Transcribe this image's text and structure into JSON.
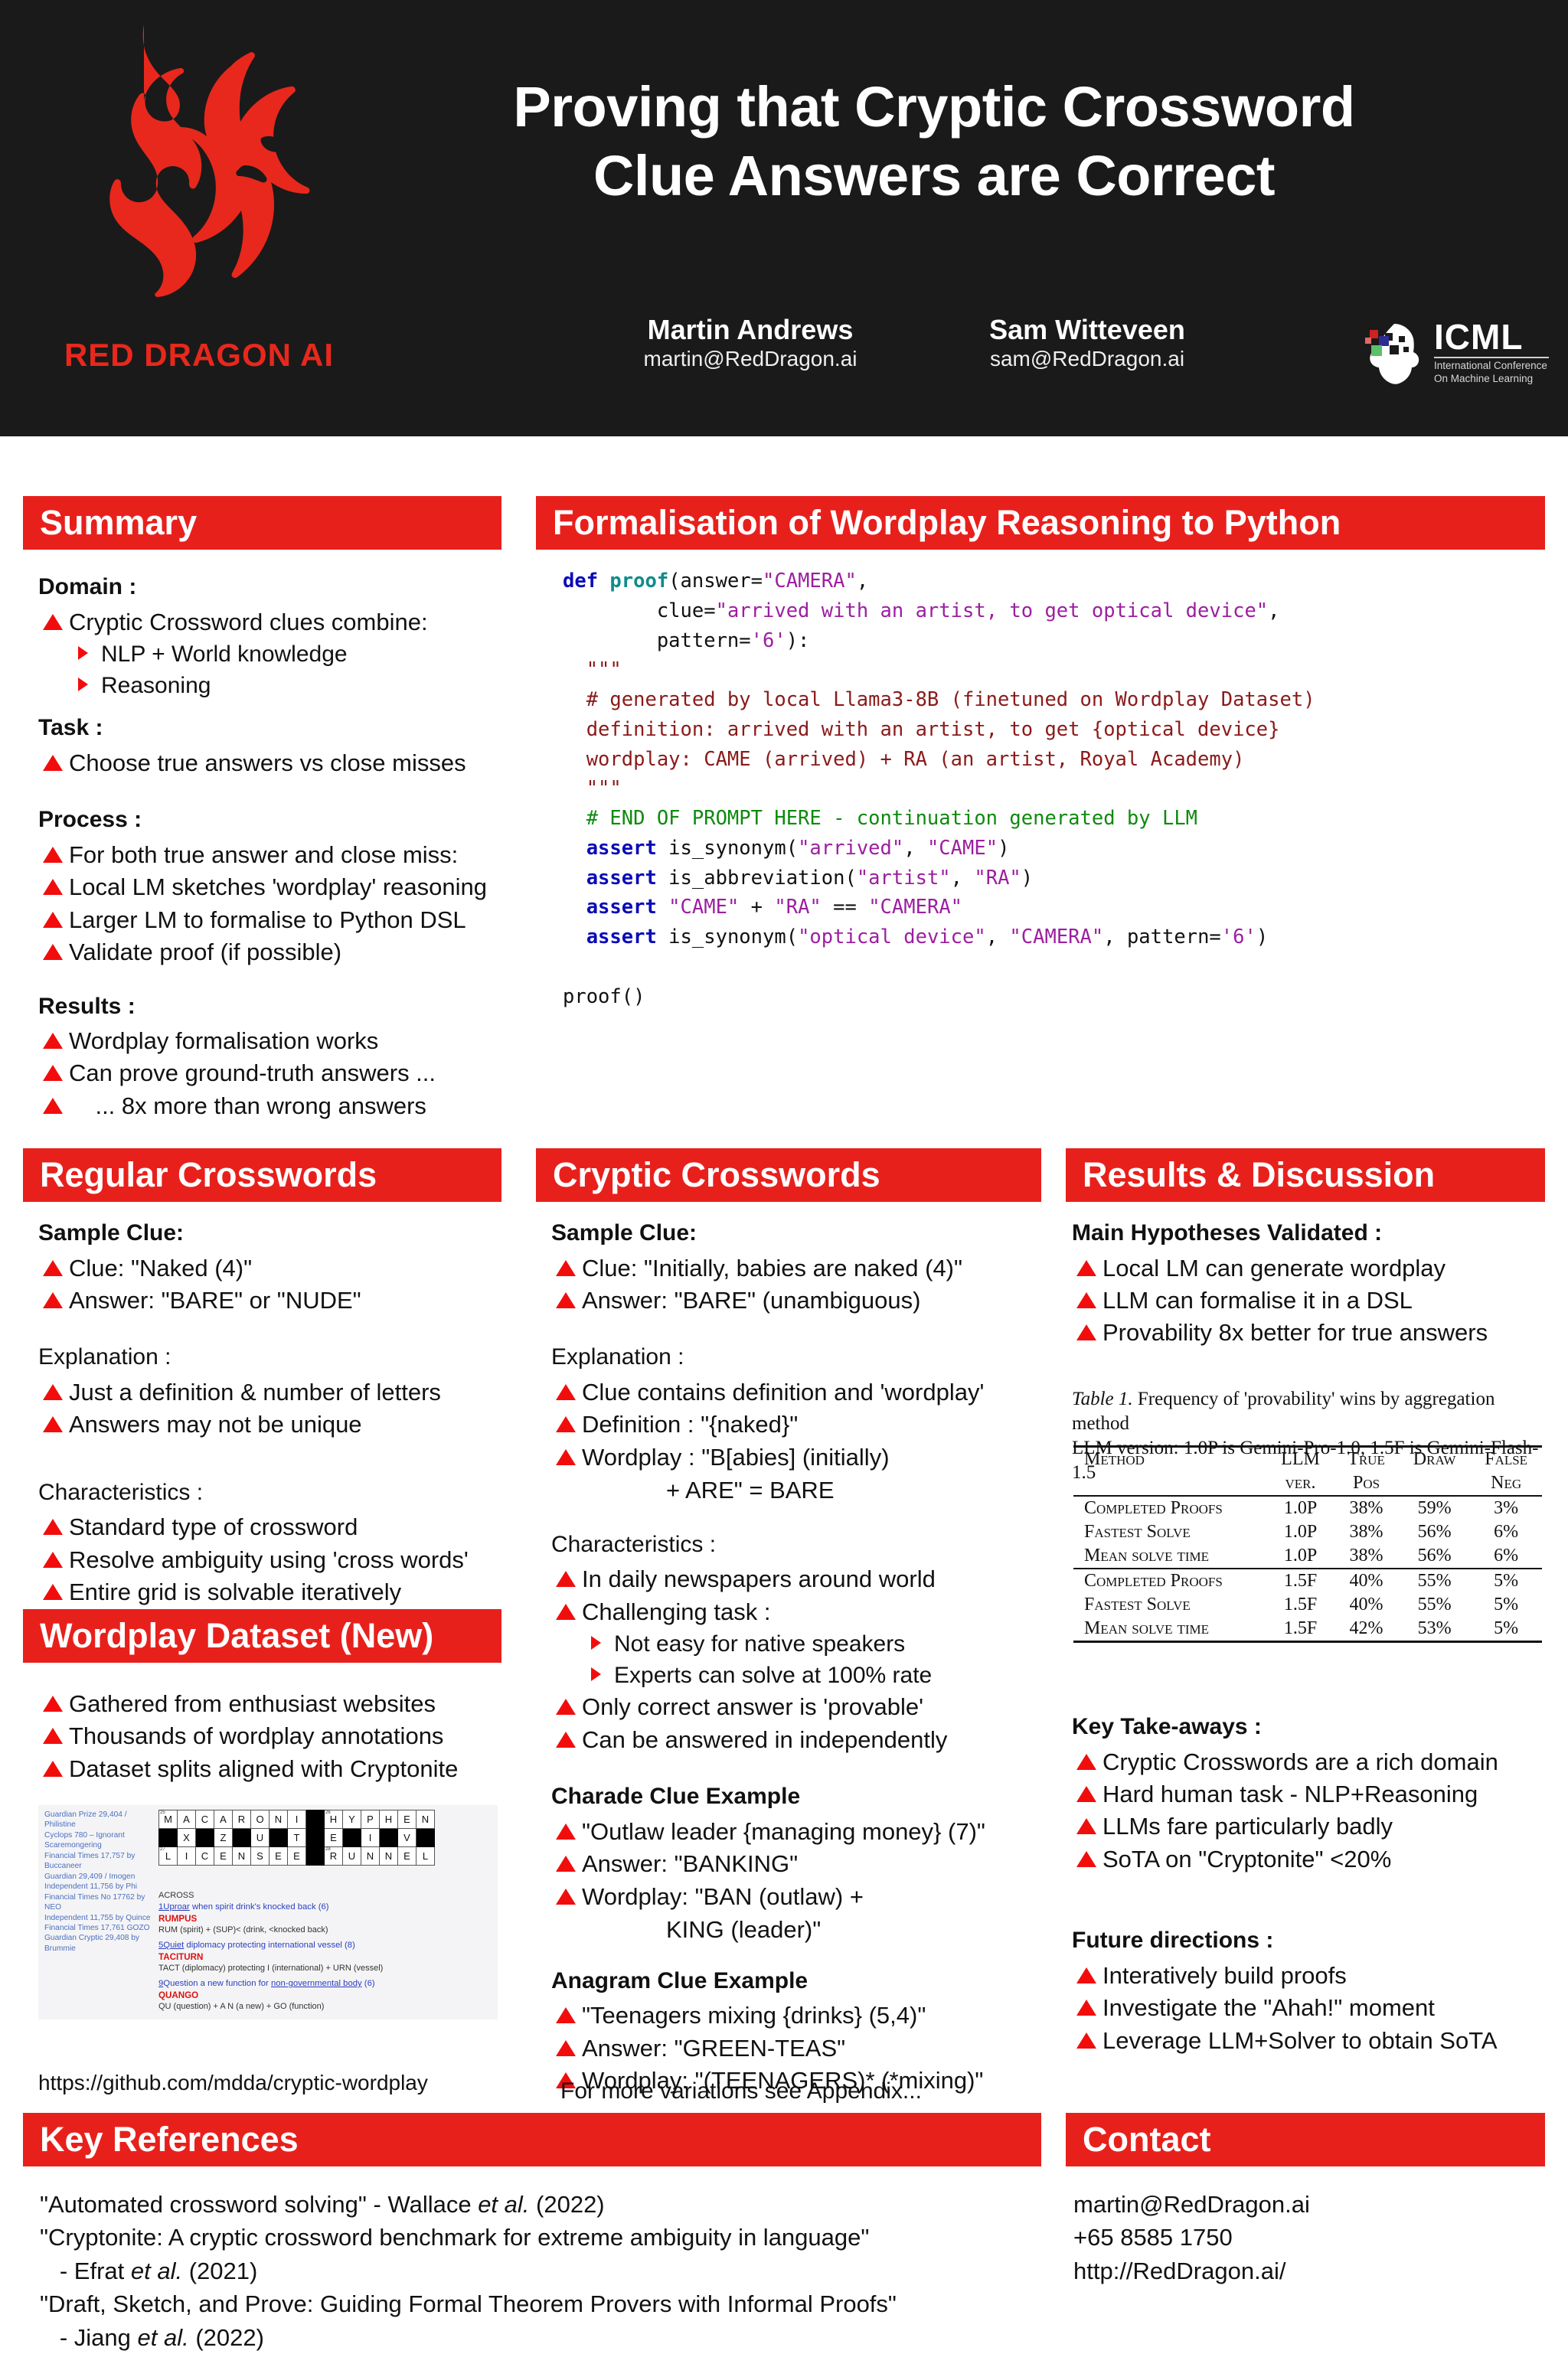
{
  "header": {
    "brand": "RED DRAGON AI",
    "title_line1": "Proving that Cryptic Crossword",
    "title_line2": "Clue Answers are Correct",
    "authors": [
      {
        "name": "Martin Andrews",
        "email": "martin@RedDragon.ai"
      },
      {
        "name": "Sam Witteveen",
        "email": "sam@RedDragon.ai"
      }
    ],
    "icml": {
      "acronym": "ICML",
      "line1": "International Conference",
      "line2": "On Machine Learning"
    },
    "colors": {
      "background": "#1a1a1a",
      "brand_red": "#e8281c"
    }
  },
  "summary": {
    "heading": "Summary",
    "domain_label": "Domain :",
    "domain_items": [
      "Cryptic Crossword clues combine:"
    ],
    "domain_sub": [
      "NLP + World knowledge",
      "Reasoning"
    ],
    "task_label": "Task :",
    "task_items": [
      "Choose true answers vs close misses"
    ],
    "process_label": "Process :",
    "process_items": [
      "For both true answer and close miss:",
      "Local LM sketches 'wordplay' reasoning",
      "Larger LM to formalise to Python DSL",
      "Validate proof (if possible)"
    ],
    "results_label": "Results :",
    "results_items": [
      "Wordplay formalisation works",
      "Can prove ground-truth answers ...",
      "    ... 8x more than wrong answers"
    ]
  },
  "formalisation": {
    "heading": "Formalisation of Wordplay Reasoning to Python",
    "code": {
      "l1_kw": "def",
      "l1_fn": "proof",
      "l1_rest_a": "(answer=",
      "l1_str_a": "\"CAMERA\"",
      "l1_rest_b": ",",
      "l2_lead": "        clue=",
      "l2_str": "\"arrived with an artist, to get optical device\"",
      "l2_tail": ",",
      "l3_lead": "        pattern=",
      "l3_str": "'6'",
      "l3_tail": "):",
      "doc_open": "  \"\"\"",
      "comment1": "  # generated by local Llama3-8B (finetuned on Wordplay Dataset)",
      "doc_def": "  definition: arrived with an artist, to get {optical device}",
      "doc_wp": "  wordplay: CAME (arrived) + RA (an artist, Royal Academy)",
      "doc_close": "  \"\"\"",
      "comment2": "  # END OF PROMPT HERE - continuation generated by LLM",
      "a1_kw": "  assert",
      "a1_fn": " is_synonym(",
      "a1_s1": "\"arrived\"",
      "a1_mid": ", ",
      "a1_s2": "\"CAME\"",
      "a1_end": ")",
      "a2_kw": "  assert",
      "a2_fn": " is_abbreviation(",
      "a2_s1": "\"artist\"",
      "a2_mid": ", ",
      "a2_s2": "\"RA\"",
      "a2_end": ")",
      "a3_kw": "  assert",
      "a3_s1": " \"CAME\"",
      "a3_mid": " + ",
      "a3_s2": "\"RA\"",
      "a3_mid2": " == ",
      "a3_s3": "\"CAMERA\"",
      "a4_kw": "  assert",
      "a4_fn": " is_synonym(",
      "a4_s1": "\"optical device\"",
      "a4_mid": ", ",
      "a4_s2": "\"CAMERA\"",
      "a4_mid2": ", pattern=",
      "a4_s3": "'6'",
      "a4_end": ")",
      "call": "proof()"
    }
  },
  "regular": {
    "heading": "Regular Crosswords",
    "sample_label": "Sample Clue:",
    "sample_items": [
      "Clue: \"Naked (4)\"",
      "Answer: \"BARE\" or \"NUDE\""
    ],
    "explanation_label": "Explanation :",
    "explanation_items": [
      "Just a definition & number of letters",
      "Answers may not be unique"
    ],
    "characteristics_label": "Characteristics :",
    "characteristics_items": [
      "Standard type of crossword",
      "Resolve ambiguity using 'cross words'",
      "Entire grid is solvable iteratively"
    ]
  },
  "dataset": {
    "heading": "Wordplay Dataset (New)",
    "items": [
      "Gathered from enthusiast websites",
      "Thousands of wordplay annotations",
      "Dataset splits aligned with Cryptonite"
    ],
    "github": "https://github.com/mdda/cryptic-wordplay",
    "screenshot": {
      "sidebar_links": [
        "Guardian Prize 29,404 / Philistine",
        "Cyclops 780 – Ignorant Scaremongering",
        "Financial Times 17,757 by Buccaneer",
        "Guardian 29,409 / Imogen",
        "Independent 11,756 by Phi",
        "Financial Times No 17762 by NEO",
        "Independent 11,755 by Quince",
        "Financial Times 17,761 GOZO",
        "Guardian Cryptic 29,408 by Brummie"
      ],
      "grid_rows": [
        [
          {
            "l": "M",
            "n": "25"
          },
          {
            "l": "A"
          },
          {
            "l": "C"
          },
          {
            "l": "A"
          },
          {
            "l": "R"
          },
          {
            "l": "O"
          },
          {
            "l": "N"
          },
          {
            "l": "I"
          },
          {
            "b": true
          },
          {
            "l": "H",
            "n": "26"
          },
          {
            "l": "Y"
          },
          {
            "l": "P"
          },
          {
            "l": "H"
          },
          {
            "l": "E"
          },
          {
            "l": "N"
          }
        ],
        [
          {
            "b": true
          },
          {
            "l": "X"
          },
          {
            "b": true
          },
          {
            "l": "Z"
          },
          {
            "b": true
          },
          {
            "l": "U"
          },
          {
            "b": true
          },
          {
            "l": "T"
          },
          {
            "b": true
          },
          {
            "l": "E"
          },
          {
            "b": true
          },
          {
            "l": "I"
          },
          {
            "b": true
          },
          {
            "l": "V"
          },
          {
            "b": true
          }
        ],
        [
          {
            "l": "L",
            "n": "27"
          },
          {
            "l": "I"
          },
          {
            "l": "C"
          },
          {
            "l": "E"
          },
          {
            "l": "N"
          },
          {
            "l": "S"
          },
          {
            "l": "E"
          },
          {
            "l": "E"
          },
          {
            "b": true
          },
          {
            "l": "R",
            "n": "28"
          },
          {
            "l": "U"
          },
          {
            "l": "N"
          },
          {
            "l": "N"
          },
          {
            "l": "E"
          },
          {
            "l": "L"
          }
        ]
      ],
      "across_label": "ACROSS",
      "clues": [
        {
          "num": "1",
          "clue_u": "Uproar",
          "clue_rest": " when spirit drink's knocked back (6)",
          "answer": "RUMPUS",
          "explain": "RUM (spirit) + (SUP)< (drink, <knocked back)"
        },
        {
          "num": "5",
          "clue_u": "Quiet",
          "clue_rest": " diplomacy protecting international vessel (8)",
          "answer": "TACITURN",
          "explain": "TACT (diplomacy) protecting I (international) + URN (vessel)"
        },
        {
          "num": "9",
          "clue_u": "",
          "clue_rest": "Question a new function for ",
          "clue_u2": "non-governmental body",
          "clue_rest2": " (6)",
          "answer": "QUANGO",
          "explain": "QU (question) + A N (a new) + GO (function)"
        }
      ]
    }
  },
  "cryptic": {
    "heading": "Cryptic Crosswords",
    "sample_label": "Sample Clue:",
    "sample_items": [
      "Clue: \"Initially, babies are naked (4)\"",
      "Answer: \"BARE\" (unambiguous)"
    ],
    "explanation_label": "Explanation :",
    "explanation_items": [
      "Clue contains definition and 'wordplay'",
      "Definition : \"{naked}\"",
      "Wordplay : \"B[abies] (initially)"
    ],
    "wordplay_cont": "+ ARE\" = BARE",
    "characteristics_label": "Characteristics :",
    "char_items_1": [
      "In daily newspapers around world",
      "Challenging task :"
    ],
    "char_sub": [
      "Not easy for native speakers",
      "Experts can solve at 100% rate"
    ],
    "char_items_2": [
      "Only correct answer is 'provable'",
      "Can be answered in independently"
    ],
    "charade_label": "Charade Clue Example",
    "charade_items": [
      "\"Outlaw leader {managing money} (7)\"",
      "Answer: \"BANKING\"",
      "Wordplay: \"BAN (outlaw) +"
    ],
    "charade_cont": "KING (leader)\"",
    "anagram_label": "Anagram Clue Example",
    "anagram_items": [
      "\"Teenagers mixing {drinks} (5,4)\"",
      "Answer: \"GREEN-TEAS\"",
      "Wordplay: \"(TEENAGERS)* (*mixing)\""
    ],
    "appendix_note": "For more variations see Appendix..."
  },
  "results": {
    "heading": "Results & Discussion",
    "hypotheses_label": "Main Hypotheses Validated :",
    "hypotheses_items": [
      "Local LM can generate wordplay",
      "LLM can formalise it in a DSL",
      "Provability 8x better for true answers"
    ],
    "table": {
      "caption_bold": "Table 1.",
      "caption_rest": " Frequency of 'provability' wins by aggregation method",
      "caption_line2": "LLM version: 1.0P is Gemini-Pro-1.0, 1.5F is Gemini-Flash-1.5",
      "headers": [
        "Method",
        "LLM ver.",
        "True Pos",
        "Draw",
        "False Neg"
      ],
      "headers_top": [
        "Method",
        "LLM",
        "True",
        "Draw",
        "False"
      ],
      "headers_bot": [
        "",
        "ver.",
        "Pos",
        "",
        "Neg"
      ],
      "rows": [
        [
          "Completed Proofs",
          "1.0P",
          "38%",
          "59%",
          "3%"
        ],
        [
          "Fastest Solve",
          "1.0P",
          "38%",
          "56%",
          "6%"
        ],
        [
          "Mean solve time",
          "1.0P",
          "38%",
          "56%",
          "6%"
        ],
        [
          "Completed Proofs",
          "1.5F",
          "40%",
          "55%",
          "5%"
        ],
        [
          "Fastest Solve",
          "1.5F",
          "40%",
          "55%",
          "5%"
        ],
        [
          "Mean solve time",
          "1.5F",
          "42%",
          "53%",
          "5%"
        ]
      ]
    },
    "takeaways_label": "Key Take-aways :",
    "takeaways_items": [
      "Cryptic Crosswords are a rich domain",
      "Hard human task - NLP+Reasoning",
      "LLMs fare particularly badly",
      "SoTA on \"Cryptonite\" <20%"
    ],
    "future_label": "Future directions :",
    "future_items": [
      "Interatively build proofs",
      "Investigate the \"Ahah!\" moment",
      "Leverage LLM+Solver to obtain SoTA"
    ]
  },
  "references": {
    "heading": "Key References",
    "items": [
      {
        "main": "\"Automated crossword solving\" - Wallace ",
        "em": "et al.",
        "tail": " (2022)"
      },
      {
        "main": "\"Cryptonite: A cryptic crossword benchmark for extreme ambiguity in language\"",
        "em": "",
        "tail": ""
      },
      {
        "main": "   - Efrat ",
        "em": "et al.",
        "tail": " (2021)"
      },
      {
        "main": "\"Draft, Sketch, and Prove: Guiding Formal Theorem Provers with Informal Proofs\"",
        "em": "",
        "tail": ""
      },
      {
        "main": "   - Jiang ",
        "em": "et al.",
        "tail": " (2022)"
      }
    ]
  },
  "contact": {
    "heading": "Contact",
    "email": "martin@RedDragon.ai",
    "phone": "+65 8585 1750",
    "website": "http://RedDragon.ai/"
  }
}
